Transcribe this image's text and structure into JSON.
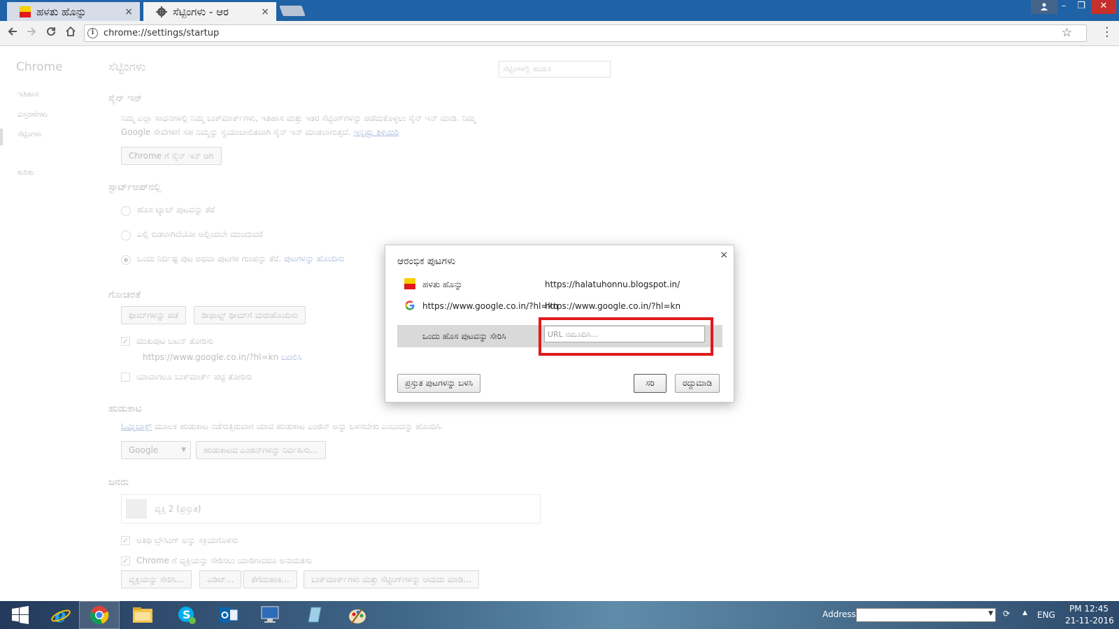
{
  "window": {
    "tabs": [
      {
        "title": "ಹಳತು ಹೊನ್ನು",
        "close": "×",
        "active": false
      },
      {
        "title": "ಸೆಟ್ಟಿಂಗಳು - ಆರ",
        "close": "×",
        "active": true
      }
    ],
    "controls": {
      "minimize": "–",
      "restore": "❐",
      "close": "✕"
    }
  },
  "toolbar": {
    "url": "chrome://settings/startup",
    "info_glyph": "i",
    "star_glyph": "☆"
  },
  "settings": {
    "brand": "Chrome",
    "title": "ಸೆಟ್ಟಿಂಗಳು",
    "search_placeholder": "ಸೆಟ್ಟಿಂಗಳಲ್ಲಿ ಹುಡುಕಿ",
    "nav": [
      "ಇತಿಹಾಸ",
      "ವಿಸ್ತರಣೆಗಳು",
      "ಸೆಟ್ಟಿಂಗಳು",
      "ಕುರಿತು"
    ],
    "signin": {
      "header": "ಸೈನ್ ಇನ್",
      "line1": "ನಿಮ್ಮ ಎಲ್ಲಾ ಸಾಧನಗಳಲ್ಲಿ ನಿಮ್ಮ ಬುಕ್‌ಮಾರ್ಕ್‌ಗಳು, ಇತಿಹಾಸ ಮತ್ತು ಇತರ ಸೆಟ್ಟಿಂಗ್‌ಗಳನ್ನು ಪಡೆದುಕೊಳ್ಳಲು ಸೈನ್ ಇನ್ ಮಾಡಿ. ನಿಮ್ಮ",
      "line2": "Google ಸೇವೆಗಳಿಗೆ ಸಹ ನಿಮ್ಮನ್ನು ಸ್ವಯಂಚಾಲಿತವಾಗಿ ಸೈನ್ ಇನ್ ಮಾಡಲಾಗುತ್ತದೆ.",
      "learn_more": "ಇನ್ನಷ್ಟು ತಿಳಿಯಿರಿ",
      "button": "Chrome ಗೆ ಸೈನ್ ಇನ್ ಆಗಿ"
    },
    "startup": {
      "header": "ಸ್ಟಾರ್ಟ್‌ಅಪ್‌ನಲ್ಲಿ",
      "opt1": "ಹೊಸ ಟ್ಯಾಬ್ ಪುಟವನ್ನು ತೆರೆ",
      "opt2": "ಎಲ್ಲಿ ಬಿಡಲಾಗಿದೆಯೋ ಅಲ್ಲಿಂದಲೇ ಮುಂದುವರೆ",
      "opt3": "ಒಂದು ನಿರ್ದಿಷ್ಟ ಪುಟ ಅಥವಾ ಪುಟಗಳ ಗುಂಪನ್ನು ತೆರೆ.",
      "opt3_link": "ಪುಟಗಳನ್ನು ಹೊಂದಿಸು"
    },
    "appearance": {
      "header": "ಗೋಚರತೆ",
      "themes_button": "ಥೀಮ್‌ಗಳನ್ನು ಪಡೆ",
      "reset_button": "ಡೀಫಾಲ್ಟ್ ಥೀಮ್‌ಗೆ ಮರುಹೊಂದಿಸು",
      "home_check": "ಮುಖಪುಟ ಬಟನ್ ತೋರಿಸು",
      "home_url": "https://www.google.co.in/?hl=kn",
      "home_change": "ಬದಲಿಸಿ",
      "bookmarks_check": "ಯಾವಾಗಲೂ ಬುಕ್‌ಮಾರ್ಕ್ ಪಟ್ಟಿ ತೋರಿಸು"
    },
    "search": {
      "header": "ಹುಡುಕಾಟ",
      "omnibox_link": "ಓಮ್ನಿಬಾಕ್ಸ್",
      "desc": "ಮೂಲಕ ಹುಡುಕಾಟ ನಡೆಸುತ್ತಿರುವಾಗ ಯಾವ ಹುಡುಕಾಟ ಎಂಜಿನ್ ಅನ್ನು ಬಳಸಬೇಕು ಎಂಬುದನ್ನು ಹೊಂದಿಸಿ.",
      "engine": "Google",
      "manage_button": "ಹುಡುಕಾಟದ ಎಂಜಿನ್‌ಗಳನ್ನು ನಿರ್ವಹಿಸು..."
    },
    "people": {
      "header": "ಜನರು",
      "person": "ವ್ಯಕ್ತಿ 2 (ಪ್ರಸ್ತುತ)",
      "guest_check": "ಅತಿಥಿ ಬ್ರೌಸಿಂಗ್ ಅನ್ನು ಸಕ್ರಿಯಗೊಳಿಸು",
      "anyone_check": "Chrome ಗೆ ವ್ಯಕ್ತಿಯನ್ನು ಸೇರಿಸಲು ಯಾರಿಗಾದರೂ ಅನುಮತಿಸು",
      "buttons": [
        "ವ್ಯಕ್ತಿಯನ್ನು ಸೇರಿಸಿ...",
        "ಎಡಿಟ್...",
        "ತೆಗೆದುಹಾಕಿ...",
        "ಬುಕ್‌ಮಾರ್ಕ್‌ಗಳು ಮತ್ತು ಸೆಟ್ಟಿಂಗ್‌ಗಳನ್ನು ಆಮದು ಮಾಡಿ..."
      ]
    }
  },
  "dialog": {
    "title": "ಆರಂಭಿಕ ಪುಟಗಳು",
    "close": "×",
    "pages": [
      {
        "name": "ಹಳತು ಹೊನ್ನು",
        "url": "https://halatuhonnu.blogspot.in/"
      },
      {
        "name": "https://www.google.co.in/?hl=kn",
        "url": "https://www.google.co.in/?hl=kn"
      }
    ],
    "add_label": "ಒಂದು ಹೊಸ ಪುಟವನ್ನು ಸೇರಿಸಿ",
    "url_placeholder": "URL ನಮೂದಿಸಿ...",
    "use_current": "ಪ್ರಸ್ತುತ ಪುಟಗಳನ್ನು ಬಳಸಿ",
    "ok": "ಸರಿ",
    "cancel": "ರದ್ದುಮಾಡಿ",
    "highlight_color": "#e0191d"
  },
  "taskbar": {
    "apps": [
      "start-icon",
      "internet-explorer-icon",
      "chrome-icon",
      "file-explorer-icon",
      "skype-icon",
      "outlook-icon",
      "computer-icon",
      "notepad-icon",
      "paint-icon"
    ],
    "address_label": "Address",
    "language": "ENG",
    "time": "PM 12:45",
    "date": "21-11-2016"
  }
}
